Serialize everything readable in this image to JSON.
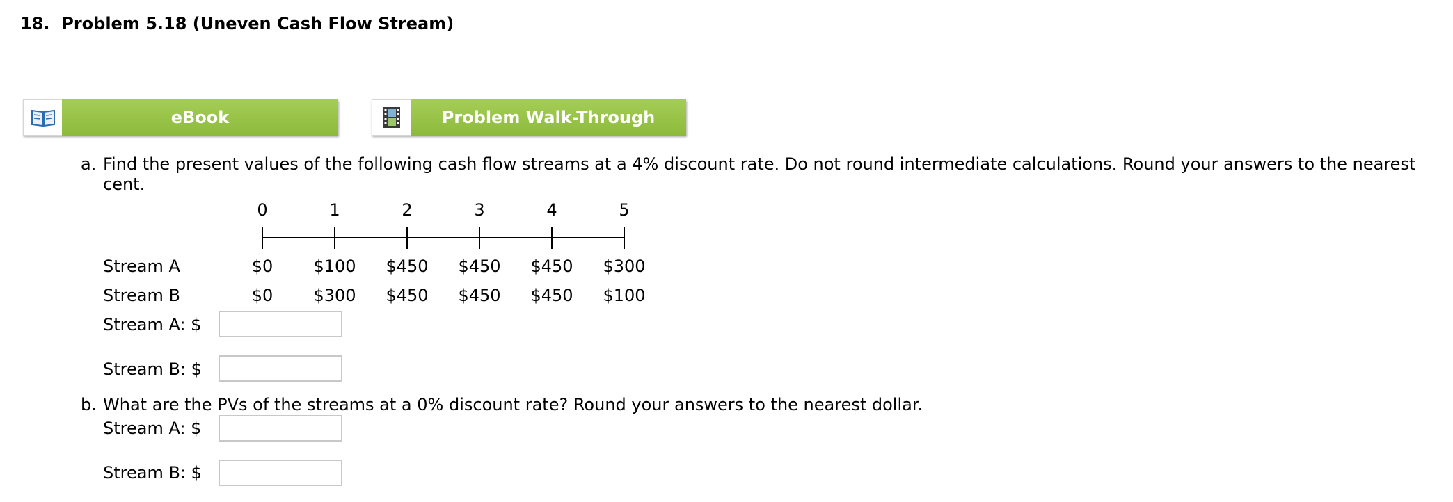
{
  "problem": {
    "number": "18.",
    "title": "Problem 5.18 (Uneven Cash Flow Stream)"
  },
  "toolbar": {
    "ebook_label": "eBook",
    "ebook_icon": "book-icon",
    "walkthrough_label": "Problem Walk-Through",
    "walkthrough_icon": "film-icon",
    "accent_color": "#97c447"
  },
  "part_a": {
    "marker": "a.",
    "text": "Find the present values of the following cash flow streams at a 4% discount rate. Do not round intermediate calculations. Round your answers to the nearest cent.",
    "timeline": {
      "periods": [
        "0",
        "1",
        "2",
        "3",
        "4",
        "5"
      ],
      "streams": [
        {
          "name": "Stream A",
          "values": [
            "$0",
            "$100",
            "$450",
            "$450",
            "$450",
            "$300"
          ]
        },
        {
          "name": "Stream B",
          "values": [
            "$0",
            "$300",
            "$450",
            "$450",
            "$450",
            "$100"
          ]
        }
      ]
    },
    "inputs": [
      {
        "label": "Stream A: $",
        "value": ""
      },
      {
        "label": "Stream B: $",
        "value": ""
      }
    ]
  },
  "part_b": {
    "marker": "b.",
    "text": "What are the PVs of the streams at a 0% discount rate? Round your answers to the nearest dollar.",
    "inputs": [
      {
        "label": "Stream A: $",
        "value": ""
      },
      {
        "label": "Stream B: $",
        "value": ""
      }
    ]
  }
}
